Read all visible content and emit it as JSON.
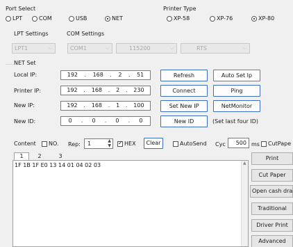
{
  "port_select": {
    "title": "Port Select",
    "options": [
      {
        "label": "LPT",
        "checked": false
      },
      {
        "label": "COM",
        "checked": false
      },
      {
        "label": "USB",
        "checked": false
      },
      {
        "label": "NET",
        "checked": true
      }
    ]
  },
  "printer_type": {
    "title": "Printer Type",
    "options": [
      {
        "label": "XP-58",
        "checked": false
      },
      {
        "label": "XP-76",
        "checked": false
      },
      {
        "label": "XP-80",
        "checked": true
      }
    ]
  },
  "lpt_settings": {
    "title": "LPT Settings",
    "value": "LPT1"
  },
  "com_settings": {
    "title": "COM Settings",
    "port": "COM1",
    "baud": "115200",
    "flow": "RTS"
  },
  "net_set": {
    "title": "NET Set",
    "local_ip": {
      "label": "Local IP:",
      "octets": [
        "192",
        "168",
        "2",
        "51"
      ]
    },
    "printer_ip": {
      "label": "Printer IP:",
      "octets": [
        "192",
        "168",
        "2",
        "230"
      ]
    },
    "new_ip": {
      "label": "New IP:",
      "octets": [
        "192",
        "168",
        "1",
        "100"
      ]
    },
    "new_id": {
      "label": "New ID:",
      "octets": [
        "0",
        "0",
        "0",
        "0"
      ]
    },
    "buttons": {
      "refresh": "Refresh",
      "auto_set_ip": "Auto Set Ip",
      "connect": "Connect",
      "ping": "Ping",
      "set_new_ip": "Set New IP",
      "net_monitor": "NetMonitor",
      "new_id": "New ID"
    },
    "hint": "(Set last four ID)"
  },
  "content_bar": {
    "content_label": "Content",
    "no_label": "NO.",
    "no_checked": false,
    "rep_label": "Rep:",
    "rep_value": "1",
    "hex_label": "HEX",
    "hex_checked": true,
    "clear_label": "Clear",
    "autosend_label": "AutoSend",
    "autosend_checked": false,
    "cyc_label": "Cyc",
    "cyc_value": "500",
    "ms_label": "ms",
    "cutpaper_label": "CutPape",
    "cutpaper_checked": false
  },
  "tabs": [
    "1",
    "2",
    "3"
  ],
  "content_text": "1F 1B 1F E0 13 14 01 04 02 03",
  "side_buttons": {
    "print": "Print",
    "cut_paper": "Cut Paper",
    "open_cash_drawer": "Open cash dra",
    "traditional": "Traditional",
    "driver_print": "Driver Print",
    "advanced": "Advanced"
  }
}
